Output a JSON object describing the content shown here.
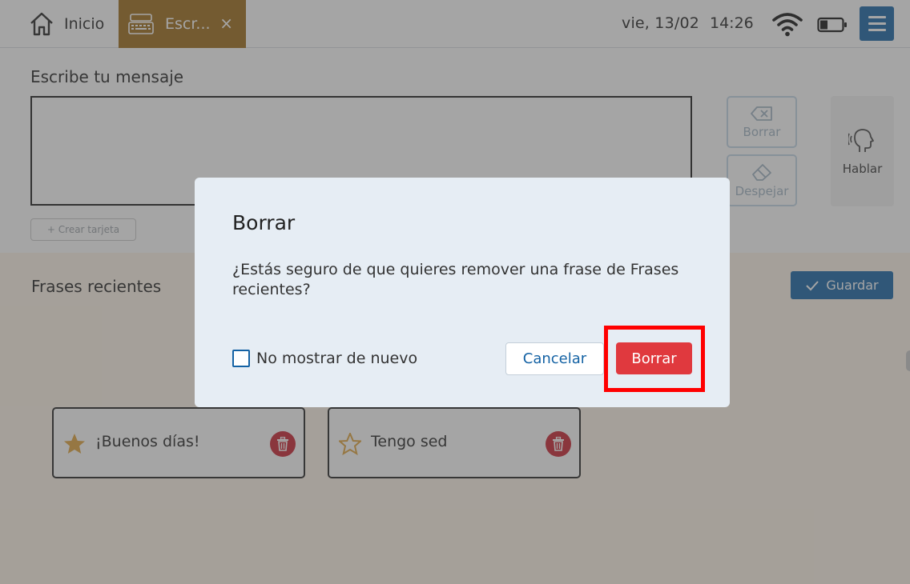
{
  "topbar": {
    "home_label": "Inicio",
    "active_tab_label": "Escr...",
    "close_glyph": "×",
    "date": "vie,  13/02",
    "time": "14:26",
    "icons": [
      "home-icon",
      "keyboard-icon",
      "close-icon",
      "wifi-icon",
      "battery-icon",
      "hamburger-menu-icon"
    ],
    "battery_level": 0.35
  },
  "message": {
    "title": "Escribe tu mensaje",
    "value": "",
    "create_card_label": "+ Crear tarjeta",
    "borrar_label": "Borrar",
    "despejar_label": "Despejar",
    "hablar_label": "Hablar"
  },
  "recent": {
    "title": "Frases recientes",
    "save_label": "Guardar",
    "cards": [
      {
        "text": "¡Buenos días!",
        "starred": true
      },
      {
        "text": "Tengo sed",
        "starred": false
      }
    ]
  },
  "dialog": {
    "title": "Borrar",
    "message": "¿Estás seguro de que quieres remover una frase de Frases recientes?",
    "checkbox_label": "No mostrar de nuevo",
    "checkbox_checked": false,
    "cancel_label": "Cancelar",
    "confirm_label": "Borrar"
  },
  "colors": {
    "primary": "#1462a4",
    "active_tab": "#9c6b17",
    "danger": "#e0393e",
    "delete_icon_bg": "#c8202f",
    "star": "#e0a33a",
    "highlight": "#ff0000",
    "recent_bg": "#fff5e8"
  }
}
